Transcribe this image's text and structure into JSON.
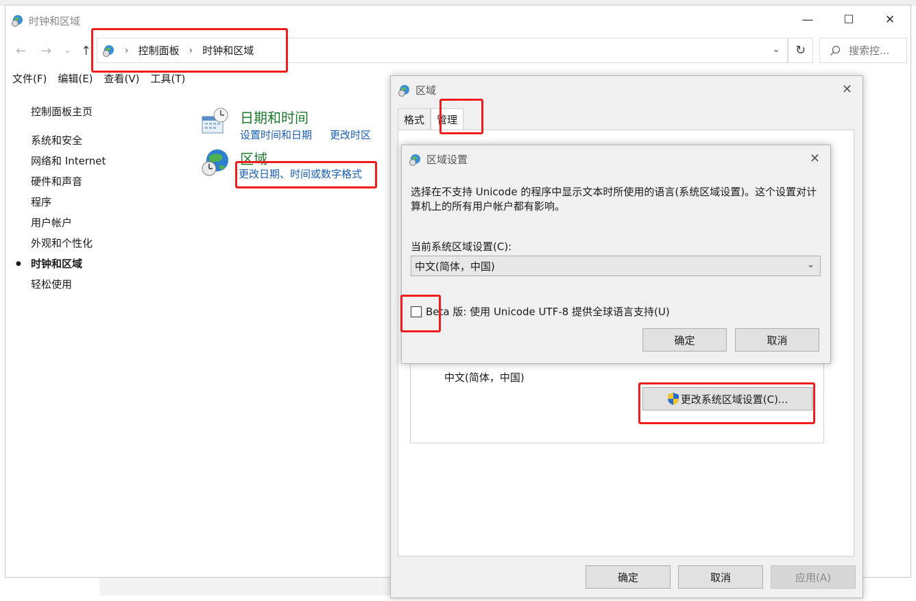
{
  "window": {
    "title": "时钟和区域",
    "minimize": "—",
    "maximize": "☐",
    "close": "✕"
  },
  "nav": {
    "back": "←",
    "forward": "→",
    "dropdown": "⌄",
    "up": "↑",
    "breadcrumb": [
      "控制面板",
      "时钟和区域"
    ],
    "breadcrumb_sep": "›",
    "addr_dropdown": "⌄",
    "refresh": "↻",
    "search_placeholder": "搜索控..."
  },
  "menu": [
    "文件(F)",
    "编辑(E)",
    "查看(V)",
    "工具(T)"
  ],
  "sidebar": {
    "home": "控制面板主页",
    "items": [
      "系统和安全",
      "网络和 Internet",
      "硬件和声音",
      "程序",
      "用户帐户",
      "外观和个性化",
      "时钟和区域",
      "轻松使用"
    ],
    "active": "时钟和区域"
  },
  "categories": [
    {
      "title": "日期和时间",
      "links": [
        "设置时间和日期",
        "更改时区"
      ]
    },
    {
      "title": "区域",
      "links": [
        "更改日期、时间或数字格式"
      ]
    }
  ],
  "region_dialog": {
    "title": "区域",
    "tabs": [
      "格式",
      "管理"
    ],
    "selected_tab": "管理",
    "current_locale": "中文(简体，中国)",
    "change_button": "更改系统区域设置(C)...",
    "ok": "确定",
    "cancel": "取消",
    "apply": "应用(A)"
  },
  "region_settings_dialog": {
    "title": "区域设置",
    "description": "选择在不支持 Unicode 的程序中显示文本时所使用的语言(系统区域设置)。这个设置对计算机上的所有用户帐户都有影响。",
    "current_label": "当前系统区域设置(C):",
    "selected_value": "中文(简体，中国)",
    "beta_label": "Beta 版: 使用 Unicode UTF-8 提供全球语言支持(U)",
    "beta_checked": false,
    "ok": "确定",
    "cancel": "取消"
  },
  "colors": {
    "highlight": "#ee1c1c",
    "category_title": "#1e7a2e",
    "link": "#1a5fb4"
  }
}
